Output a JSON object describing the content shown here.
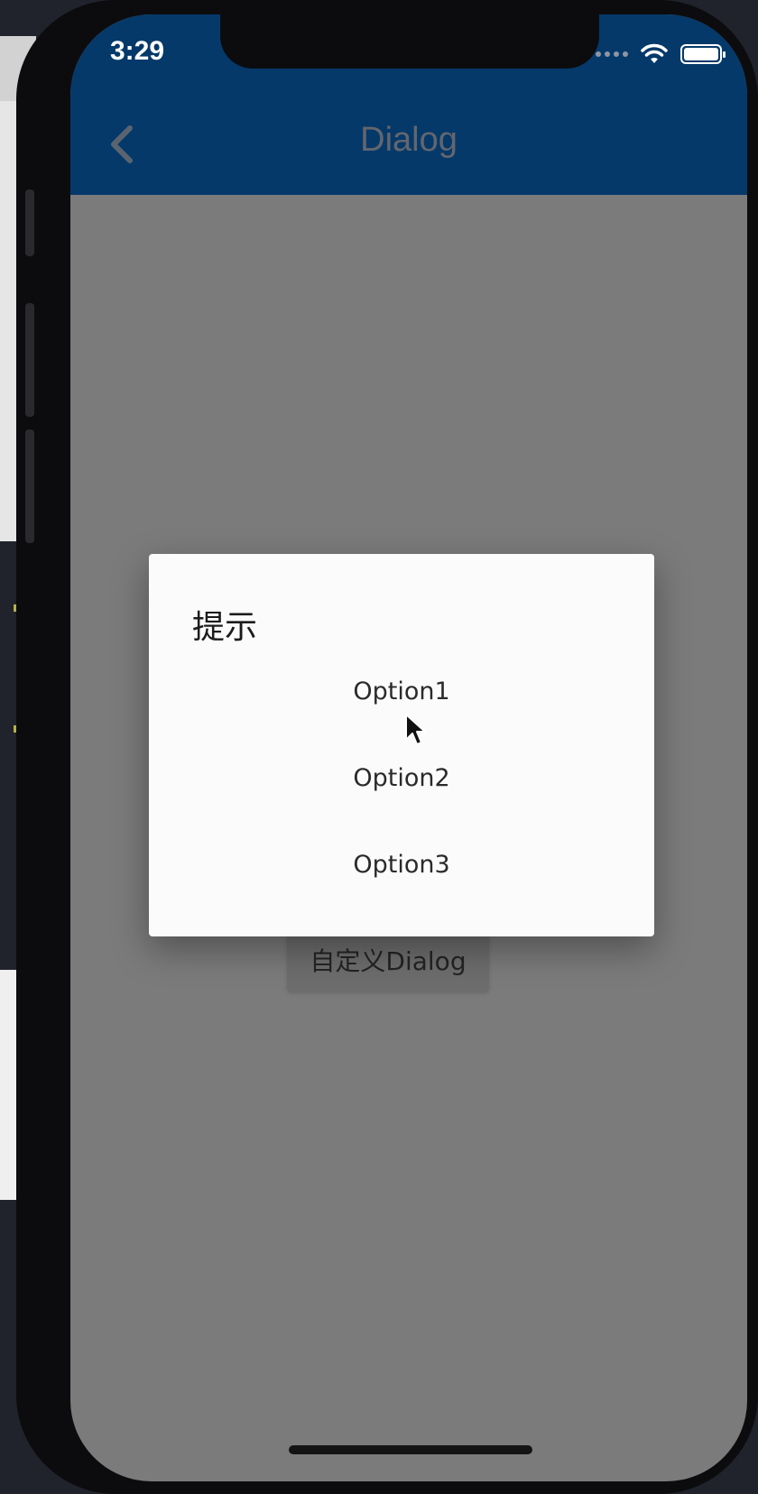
{
  "status_bar": {
    "time": "3:29"
  },
  "app_bar": {
    "title": "Dialog",
    "back_icon": "chevron-left-icon"
  },
  "dialog": {
    "title": "提示",
    "options": [
      "Option1",
      "Option2",
      "Option3"
    ]
  },
  "page": {
    "custom_dialog_button_label": "自定义Dialog"
  },
  "colors": {
    "app_bar": "#05396a",
    "scrim": "#7b7b7b",
    "dialog_bg": "#fbfbfb"
  }
}
